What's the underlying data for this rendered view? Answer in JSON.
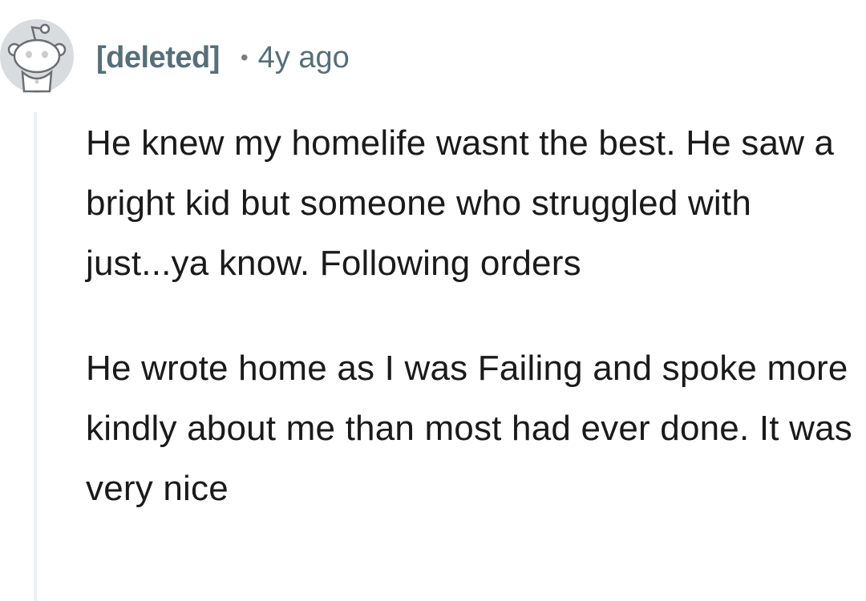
{
  "comment": {
    "author": "[deleted]",
    "separator": "•",
    "age": "4y ago",
    "avatar_icon": "snoo-avatar-icon",
    "paragraphs": [
      "He knew my homelife wasnt the best. He saw a bright kid but someone who struggled with just...ya know. Following orders",
      "He wrote home as I was Failing and spoke more kindly about me than most had ever done. It was very nice"
    ]
  },
  "colors": {
    "author": "#576f76",
    "text": "#1a1a1b",
    "thread_line": "#edeff1",
    "avatar_bg": "#d9dcdf"
  }
}
